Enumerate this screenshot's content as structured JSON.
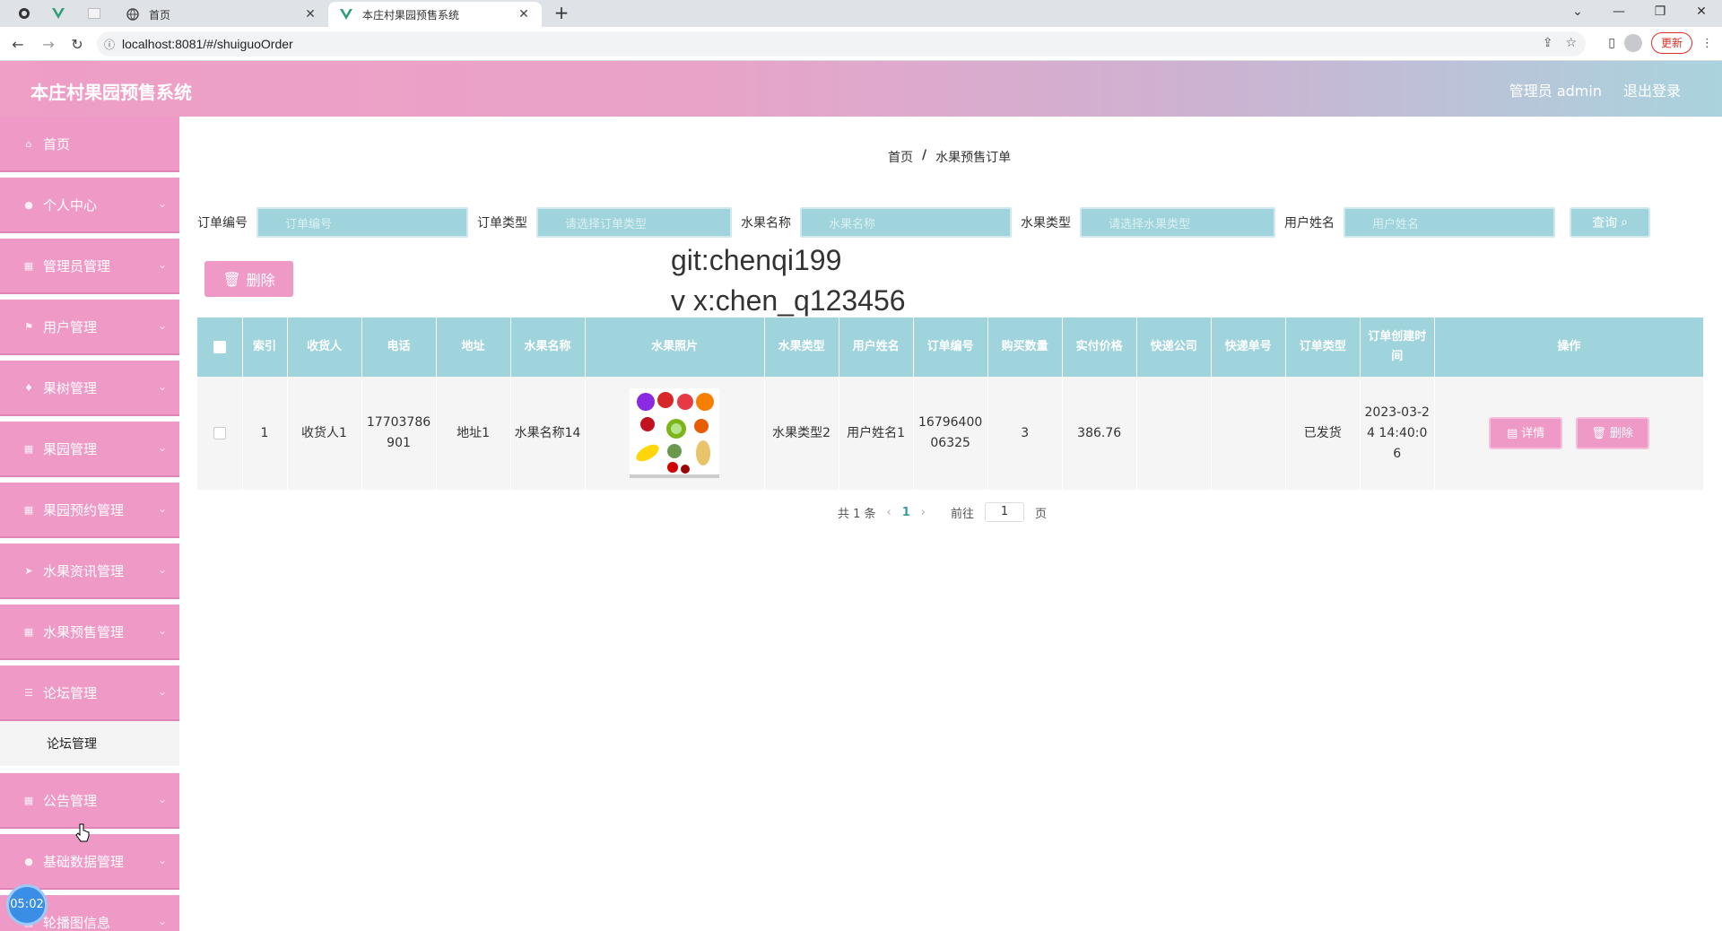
{
  "browser": {
    "tabs": [
      {
        "title": "首页",
        "active": false
      },
      {
        "title": "本庄村果园预售系统",
        "active": true
      }
    ],
    "url": "localhost:8081/#/shuiguoOrder",
    "update_label": "更新"
  },
  "header": {
    "title": "本庄村果园预售系统",
    "user_label": "管理员 admin",
    "logout_label": "退出登录"
  },
  "sidebar": {
    "items": [
      {
        "label": "首页",
        "icon": "home-icon"
      },
      {
        "label": "个人中心",
        "icon": "user-icon"
      },
      {
        "label": "管理员管理",
        "icon": "grid-icon"
      },
      {
        "label": "用户管理",
        "icon": "flag-icon"
      },
      {
        "label": "果树管理",
        "icon": "bulb-icon"
      },
      {
        "label": "果园管理",
        "icon": "grid-icon"
      },
      {
        "label": "果园预约管理",
        "icon": "grid-icon"
      },
      {
        "label": "水果资讯管理",
        "icon": "send-icon"
      },
      {
        "label": "水果预售管理",
        "icon": "grid-icon"
      },
      {
        "label": "论坛管理",
        "icon": "list-icon"
      },
      {
        "label": "公告管理",
        "icon": "grid-icon"
      },
      {
        "label": "基础数据管理",
        "icon": "user-icon"
      },
      {
        "label": "轮播图信息",
        "icon": "grid-icon"
      }
    ],
    "submenu_label": "论坛管理"
  },
  "timer": "05:02",
  "breadcrumb": {
    "home": "首页",
    "sep": "/",
    "current": "水果预售订单"
  },
  "search": {
    "fields": [
      {
        "label": "订单编号",
        "placeholder": "订单编号"
      },
      {
        "label": "订单类型",
        "placeholder": "请选择订单类型"
      },
      {
        "label": "水果名称",
        "placeholder": "水果名称"
      },
      {
        "label": "水果类型",
        "placeholder": "请选择水果类型"
      },
      {
        "label": "用户姓名",
        "placeholder": "用户姓名"
      }
    ],
    "query_label": "查询"
  },
  "delete_label": "删除",
  "watermark": {
    "line1": "git:chenqi199",
    "line2": "v x:chen_q123456"
  },
  "table": {
    "headers": [
      "索引",
      "收货人",
      "电话",
      "地址",
      "水果名称",
      "水果照片",
      "水果类型",
      "用户姓名",
      "订单编号",
      "购买数量",
      "实付价格",
      "快递公司",
      "快递单号",
      "订单类型",
      "订单创建时间",
      "操作"
    ],
    "rows": [
      {
        "index": "1",
        "receiver": "收货人1",
        "phone": "17703786901",
        "address": "地址1",
        "fruit_name": "水果名称14",
        "fruit_type": "水果类型2",
        "user_name": "用户姓名1",
        "order_no": "1679640006325",
        "quantity": "3",
        "price": "386.76",
        "express_company": "",
        "express_no": "",
        "order_type": "已发货",
        "created": "2023-03-24 14:40:06"
      }
    ],
    "detail_label": "详情",
    "delete_label": "删除"
  },
  "pager": {
    "total": "共 1 条",
    "page": "1",
    "goto_label": "前往",
    "goto_value": "1",
    "page_suffix": "页"
  },
  "colors": {
    "pink": "#ef99c6",
    "teal": "#9fd4dc"
  }
}
